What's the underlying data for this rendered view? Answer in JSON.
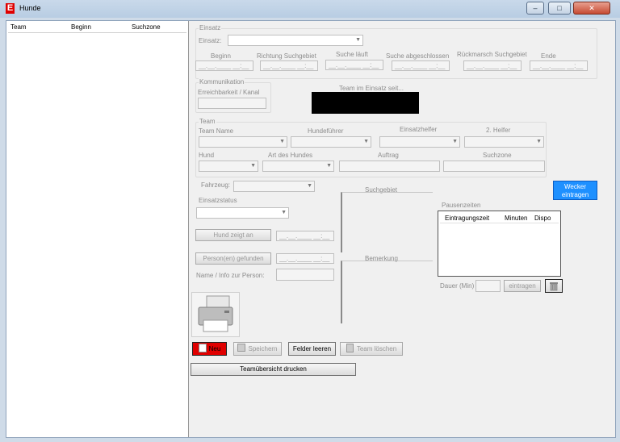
{
  "window": {
    "app_icon": "E",
    "title": "Hunde",
    "min": "‒",
    "max": "□",
    "close": "✕"
  },
  "list": {
    "columns": [
      "Team",
      "Beginn",
      "Suchzone"
    ]
  },
  "einsatz": {
    "group": "Einsatz",
    "einsatz_label": "Einsatz:",
    "time_labels": [
      "Beginn",
      "Richtung Suchgebiet",
      "Suche läuft",
      "Suche abgeschlossen",
      "Rückmarsch Suchgebiet",
      "Ende"
    ],
    "time_mask": "__.__.____ __:__"
  },
  "kommunikation": {
    "group": "Kommunikation",
    "erreichbarkeit_label": "Erreichbarkeit / Kanal",
    "team_seit_label": "Team im Einsatz seit..."
  },
  "team": {
    "group": "Team",
    "labels": {
      "team_name": "Team Name",
      "hundefuehrer": "Hundeführer",
      "einsatzhelfer": "Einsatzhelfer",
      "helfer2": "2. Helfer",
      "hund": "Hund",
      "art": "Art des Hundes",
      "auftrag": "Auftrag",
      "suchzone": "Suchzone"
    }
  },
  "fahrzeug_label": "Fahrzeug:",
  "einsatzstatus_label": "Einsatzstatus",
  "suchgebiet_label": "Suchgebiet",
  "bemerkung_label": "Bemerkung",
  "hund_zeigt_an_button": "Hund zeigt an",
  "person_gefunden_button": "Person(en) gefunden",
  "name_info_label": "Name / Info zur Person:",
  "time_mask_short": "__.__.____ __:__",
  "wecker_button": "Wecker eintragen",
  "pausen": {
    "group": "Pausenzeiten",
    "columns": [
      "Eintragungszeit",
      "Minuten",
      "Dispo"
    ],
    "dauer_label": "Dauer (Min)",
    "eintragen_button": "eintragen"
  },
  "actions": {
    "neu": "Neu",
    "speichern": "Speichern",
    "felder_leeren": "Felder leeren",
    "team_loeschen": "Team löschen",
    "teamuebersicht": "Teamübersicht drucken"
  },
  "colors": {
    "accent_blue": "#1e90ff",
    "neu_red": "#e00000",
    "title_bar": "#c9d9ea"
  }
}
